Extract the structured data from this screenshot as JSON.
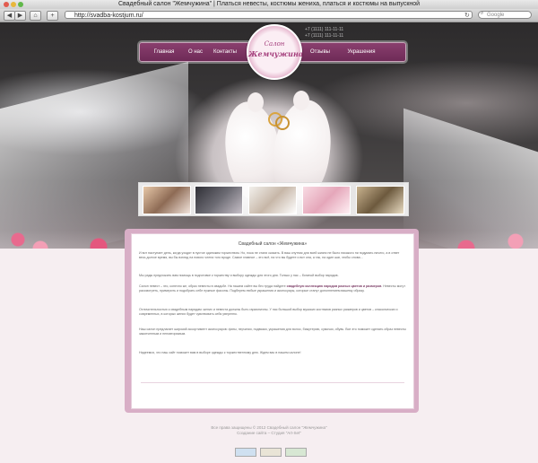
{
  "window": {
    "title": "Свадебный салон \"Жемчужина\" | Платься невесты, костюмы жениха, платься и костюмы на выпускной"
  },
  "toolbar": {
    "url": "http://svadba-kostjum.ru/",
    "search_placeholder": "Google",
    "back_icon": "back-arrow-icon",
    "forward_icon": "forward-arrow-icon",
    "home_icon": "home-icon",
    "add_icon": "plus-icon"
  },
  "site": {
    "logo_line1": "Салон",
    "logo_line2": "Жемчужина",
    "nav": [
      "Главная",
      "О нас",
      "Контакты",
      "Отзывы",
      "Украшения"
    ],
    "contact_lines": [
      "+7 (1111) 111-11-11",
      "+7 (1111) 111-11-11"
    ]
  },
  "content": {
    "heading": "Свадебный салон «Жемчужина»",
    "p1": "И вот наступает день, когда уходят в пустое одиноким торжеством. Но, пока не стали сказать. В ваш спутник для всей жизни не было никакого ни подумать ничего, а в ответ весь долгое время, вы бы взгляд на нового члена того вроде. Самое главное – это всё, на что вы будете и вот она, а так, на один шаг, чтобы снова…",
    "p2": "Мы рады предложить вам помощь в подготовке к торжеству и выбору одежды для этого дня. Только у нас – богатый выбор нарядов.",
    "p3_pre": "Салон невест – это, конечно же, образ невесты в свадьбе. На нашем сайте вы без труда найдете ",
    "p3_hl": "свадебную коллекцию нарядов разных цветов и размеров",
    "p3_post": ". Невесты могут рассмотреть, примерить и подобрать себе нужные фасоны. Подберем любые украшения и аксессуары, которые станут дополнением вашему образу.",
    "p4": "Отличительностью к свадебным нарядам: жених и невеста должны быть гармоничны. У нас большой выбор мужских костюмов разных размеров и цветов – классических и современных, в которых жених будет чувствовать себя уверенно.",
    "p5": "Наш салон предлагает широкий ассортимент аксессуаров: фаты, перчатки, подвязки, украшения для волос, бижутерию, сумочки, обувь. Все это поможет сделать образ невесты законченным и неповторимым.",
    "p6": "Надеемся, что наш сайт поможет вам в выборе одежды к торжественному дню. Ждем вас в нашем салоне!"
  },
  "footer": {
    "line1": "Все права защищены © 2012 Свадебный салон \"Жемчужина\"",
    "line2": "Создание сайта – Студия \"Art-Set\""
  },
  "colors": {
    "accent": "#7a3a64",
    "nav_bg": "#7c3562",
    "page_bg": "#f6eef1",
    "frame": "#d8aec6"
  }
}
